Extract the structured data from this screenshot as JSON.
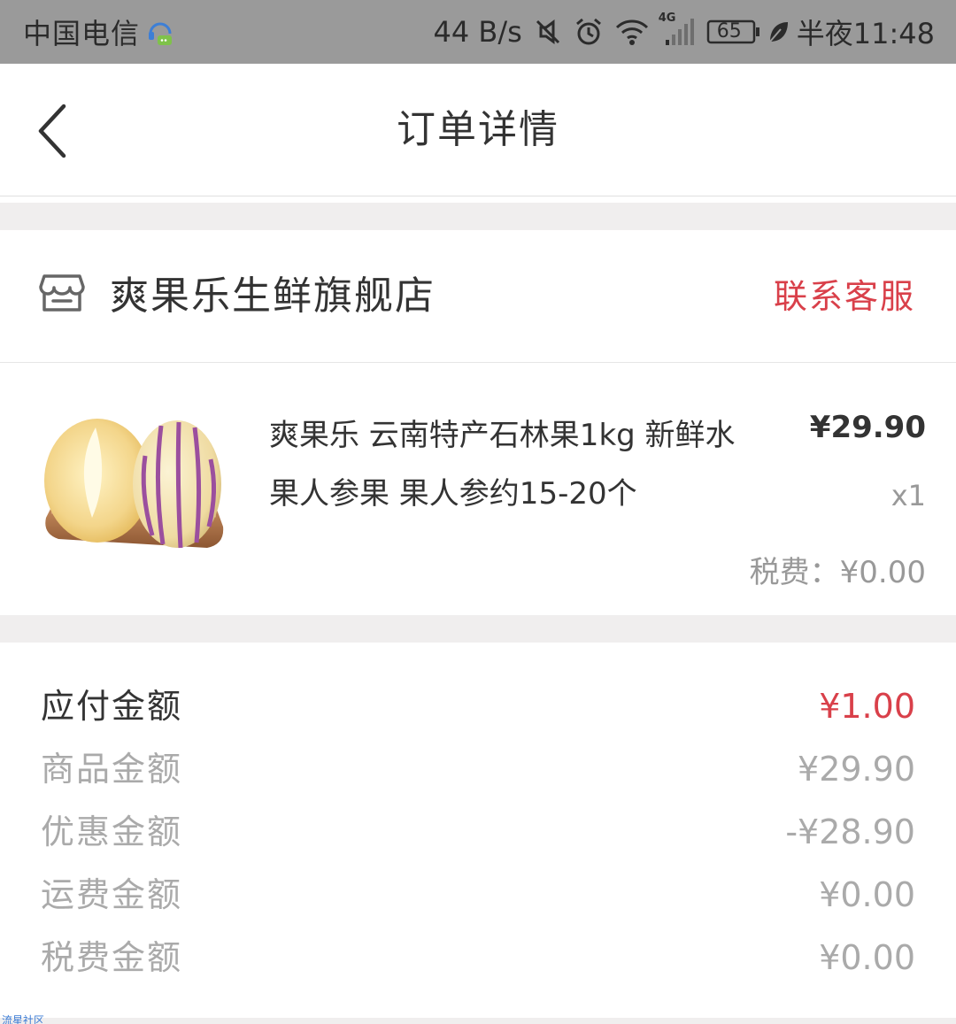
{
  "status_bar": {
    "carrier": "中国电信",
    "net_speed": "44 B/s",
    "network_type": "4G",
    "battery": "65",
    "time": "半夜11:48",
    "icons": [
      "assistant-icon",
      "mute-icon",
      "alarm-icon",
      "wifi-icon",
      "signal-icon",
      "battery-icon",
      "leaf-icon"
    ]
  },
  "nav": {
    "title": "订单详情",
    "back_icon": "chevron-left-icon"
  },
  "store": {
    "name": "爽果乐生鲜旗舰店",
    "contact_label": "联系客服",
    "icon": "store-icon"
  },
  "product": {
    "title": "爽果乐 云南特产石林果1kg 新鲜水果人参果 果人参约15-20个",
    "price": "¥29.90",
    "quantity": "x1",
    "tax_label": "税费：",
    "tax_value": "¥0.00"
  },
  "summary": {
    "rows": [
      {
        "label": "应付金额",
        "value": "¥1.00"
      },
      {
        "label": "商品金额",
        "value": "¥29.90"
      },
      {
        "label": "优惠金额",
        "value": "-¥28.90"
      },
      {
        "label": "运费金额",
        "value": "¥0.00"
      },
      {
        "label": "税费金额",
        "value": "¥0.00"
      }
    ]
  },
  "watermark": "流星社区",
  "colors": {
    "accent": "#d9404a",
    "status_bar": "#9a9a9a",
    "divider": "#f0eeee",
    "muted_text": "#aaaaaa"
  }
}
